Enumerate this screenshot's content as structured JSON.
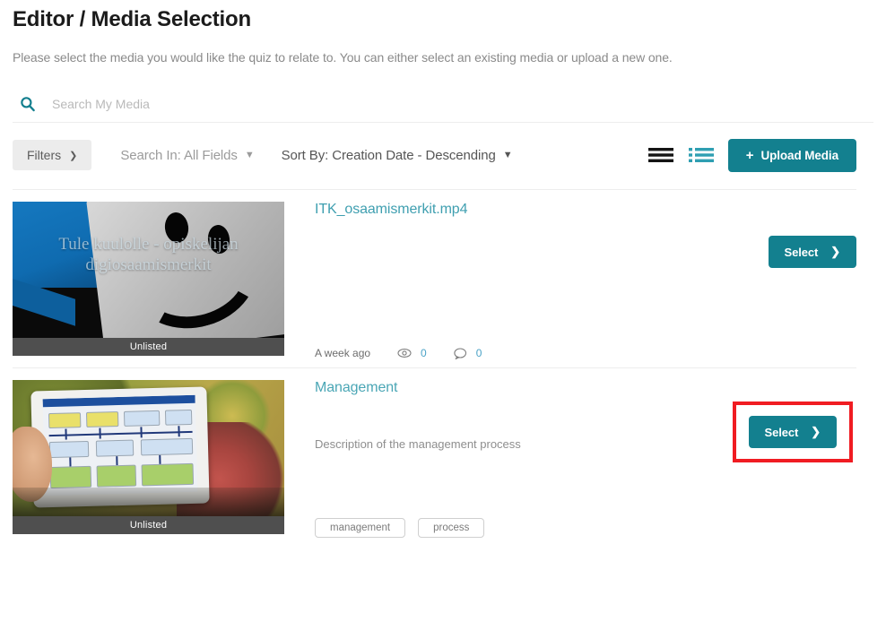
{
  "header": {
    "title": "Editor / Media Selection",
    "subtitle": "Please select the media you would like the quiz to relate to. You can either select an existing media or upload a new one."
  },
  "search": {
    "icon": "search-icon",
    "placeholder": "Search My Media",
    "value": ""
  },
  "filter_bar": {
    "filters_label": "Filters",
    "filters_chevron": "›",
    "search_in_label": "Search In: All Fields",
    "sort_by_label": "Sort By: Creation Date - Descending",
    "chevron_down": "⌄",
    "table_view_icon": "table-view-icon",
    "detail_view_icon": "detail-view-icon",
    "upload_label": "Upload Media",
    "upload_plus": "+"
  },
  "colors": {
    "teal": "#13808f",
    "link_teal": "#3f9fb0",
    "highlight_red": "#f01c22",
    "muted_text": "#8e8e8e"
  },
  "media": [
    {
      "title": "ITK_osaamismerkit.mp4",
      "thumbnail_overlay_text": "Tule kuulolle - opiskelijan digiosaamismerkit",
      "privacy_badge": "Unlisted",
      "description": "",
      "created": "A week ago",
      "views": "0",
      "comments": "0",
      "tags": [],
      "select_label": "Select",
      "select_chevron": "❯",
      "highlighted": false
    },
    {
      "title": "Management",
      "thumbnail_overlay_text": "",
      "privacy_badge": "Unlisted",
      "description": "Description of the management process",
      "created": "",
      "views": "",
      "comments": "",
      "tags": [
        "management",
        "process"
      ],
      "select_label": "Select",
      "select_chevron": "❯",
      "highlighted": true
    }
  ]
}
